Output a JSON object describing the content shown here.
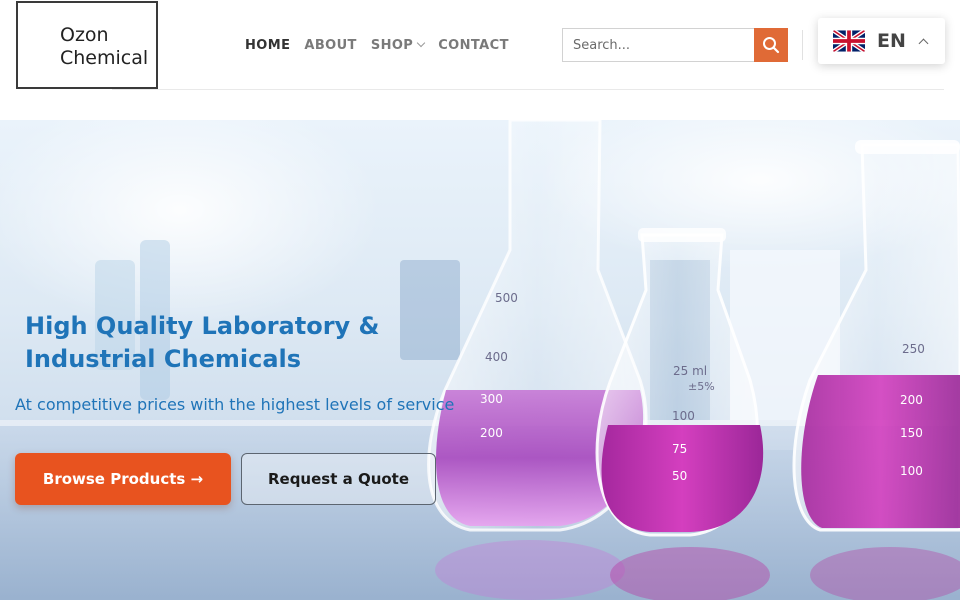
{
  "logo": {
    "line1": "Ozon",
    "line2": "Chemical"
  },
  "nav": {
    "items": [
      {
        "label": "HOME",
        "active": true
      },
      {
        "label": "ABOUT",
        "active": false
      },
      {
        "label": "SHOP",
        "active": false,
        "has_dropdown": true
      },
      {
        "label": "CONTACT",
        "active": false
      }
    ]
  },
  "search": {
    "placeholder": "Search...",
    "value": ""
  },
  "language": {
    "code": "EN",
    "flag": "uk-flag-icon"
  },
  "hero": {
    "title": "High Quality Laboratory & Industrial Chemicals",
    "subtitle": "At competitive prices with the highest levels of service",
    "primary_button": "Browse Products →",
    "secondary_button": "Request a Quote",
    "flask_markings": [
      "500",
      "400",
      "300",
      "200",
      "25 ml",
      "±5%",
      "100",
      "75",
      "50",
      "250",
      "200",
      "150",
      "100"
    ]
  },
  "colors": {
    "accent": "#e8531f",
    "search_button": "#e06a36",
    "headline_blue": "#1f74b8",
    "liquid": "#b04fc4"
  }
}
